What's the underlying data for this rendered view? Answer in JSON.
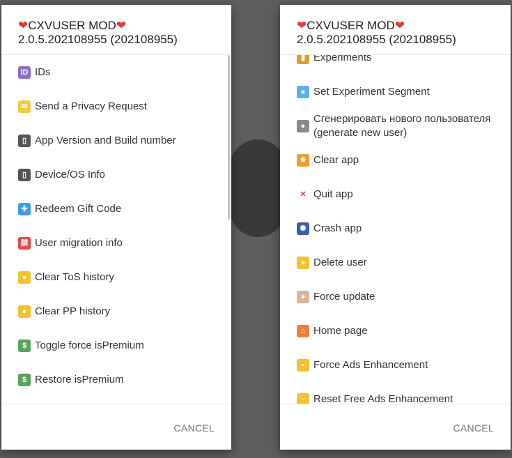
{
  "dialogs": [
    {
      "title": "CXVUSER MOD",
      "version": "2.0.5.202108955 (202108955)",
      "items": [
        {
          "icon": "id-icon",
          "label": "IDs"
        },
        {
          "icon": "envelope-icon",
          "label": "Send a Privacy Request"
        },
        {
          "icon": "mobile-phone-icon",
          "label": "App Version and Build number"
        },
        {
          "icon": "mobile-phone-icon",
          "label": "Device/OS Info"
        },
        {
          "icon": "gift-icon",
          "label": "Redeem Gift Code"
        },
        {
          "icon": "prohibited-sign-icon",
          "label": "User migration info"
        },
        {
          "icon": "sponge-icon",
          "label": "Clear ToS history"
        },
        {
          "icon": "sponge-icon",
          "label": "Clear PP history"
        },
        {
          "icon": "money-wings-icon",
          "label": "Toggle force isPremium"
        },
        {
          "icon": "money-wings-icon",
          "label": "Restore isPremium"
        }
      ],
      "cancel": "CANCEL"
    },
    {
      "title": "CXVUSER MOD",
      "version": "2.0.5.202108955 (202108955)",
      "items": [
        {
          "icon": "bar-chart-icon",
          "label": "Experiments"
        },
        {
          "icon": "crystal-ball-icon",
          "label": "Set Experiment Segment"
        },
        {
          "icon": "alien-icon",
          "label": "Сгенерировать нового пользователя (generate new user)"
        },
        {
          "icon": "collision-icon",
          "label": "Clear app"
        },
        {
          "icon": "cross-mark-icon",
          "label": "Quit app"
        },
        {
          "icon": "fireworks-icon",
          "label": "Crash app"
        },
        {
          "icon": "sponge-icon",
          "label": "Delete user"
        },
        {
          "icon": "flexed-biceps-icon",
          "label": "Force update"
        },
        {
          "icon": "house-icon",
          "label": "Home page"
        },
        {
          "icon": "lock-icon",
          "label": "Force Ads Enhancement"
        },
        {
          "icon": "unlock-icon",
          "label": "Reset Free Ads Enhancement"
        }
      ],
      "cancel": "CANCEL"
    }
  ],
  "icon_styles": {
    "id-icon": {
      "bg": "#8e6cc9",
      "glyph": "ID"
    },
    "envelope-icon": {
      "bg": "#f5c842",
      "glyph": "✉"
    },
    "mobile-phone-icon": {
      "bg": "#555555",
      "glyph": "▯"
    },
    "gift-icon": {
      "bg": "#3d9be9",
      "glyph": "✚"
    },
    "prohibited-sign-icon": {
      "bg": "#e04848",
      "glyph": "禁"
    },
    "sponge-icon": {
      "bg": "#f2c230",
      "glyph": "●"
    },
    "money-wings-icon": {
      "bg": "#5aa25a",
      "glyph": "$"
    },
    "bar-chart-icon": {
      "bg": "#d9a030",
      "glyph": "▮"
    },
    "crystal-ball-icon": {
      "bg": "#5ab0e8",
      "glyph": "●"
    },
    "alien-icon": {
      "bg": "#8a8a8a",
      "glyph": "●"
    },
    "collision-icon": {
      "bg": "#f59b2a",
      "glyph": "✸"
    },
    "cross-mark-icon": {
      "bg": "#ffffff",
      "glyph": "✕",
      "color": "#e53935"
    },
    "fireworks-icon": {
      "bg": "#3a5fa8",
      "glyph": "✺"
    },
    "flexed-biceps-icon": {
      "bg": "#d9b49a",
      "glyph": "●"
    },
    "house-icon": {
      "bg": "#e8803a",
      "glyph": "⌂"
    },
    "lock-icon": {
      "bg": "#f2c230",
      "glyph": "▪"
    },
    "unlock-icon": {
      "bg": "#f2c230",
      "glyph": "▫"
    }
  }
}
